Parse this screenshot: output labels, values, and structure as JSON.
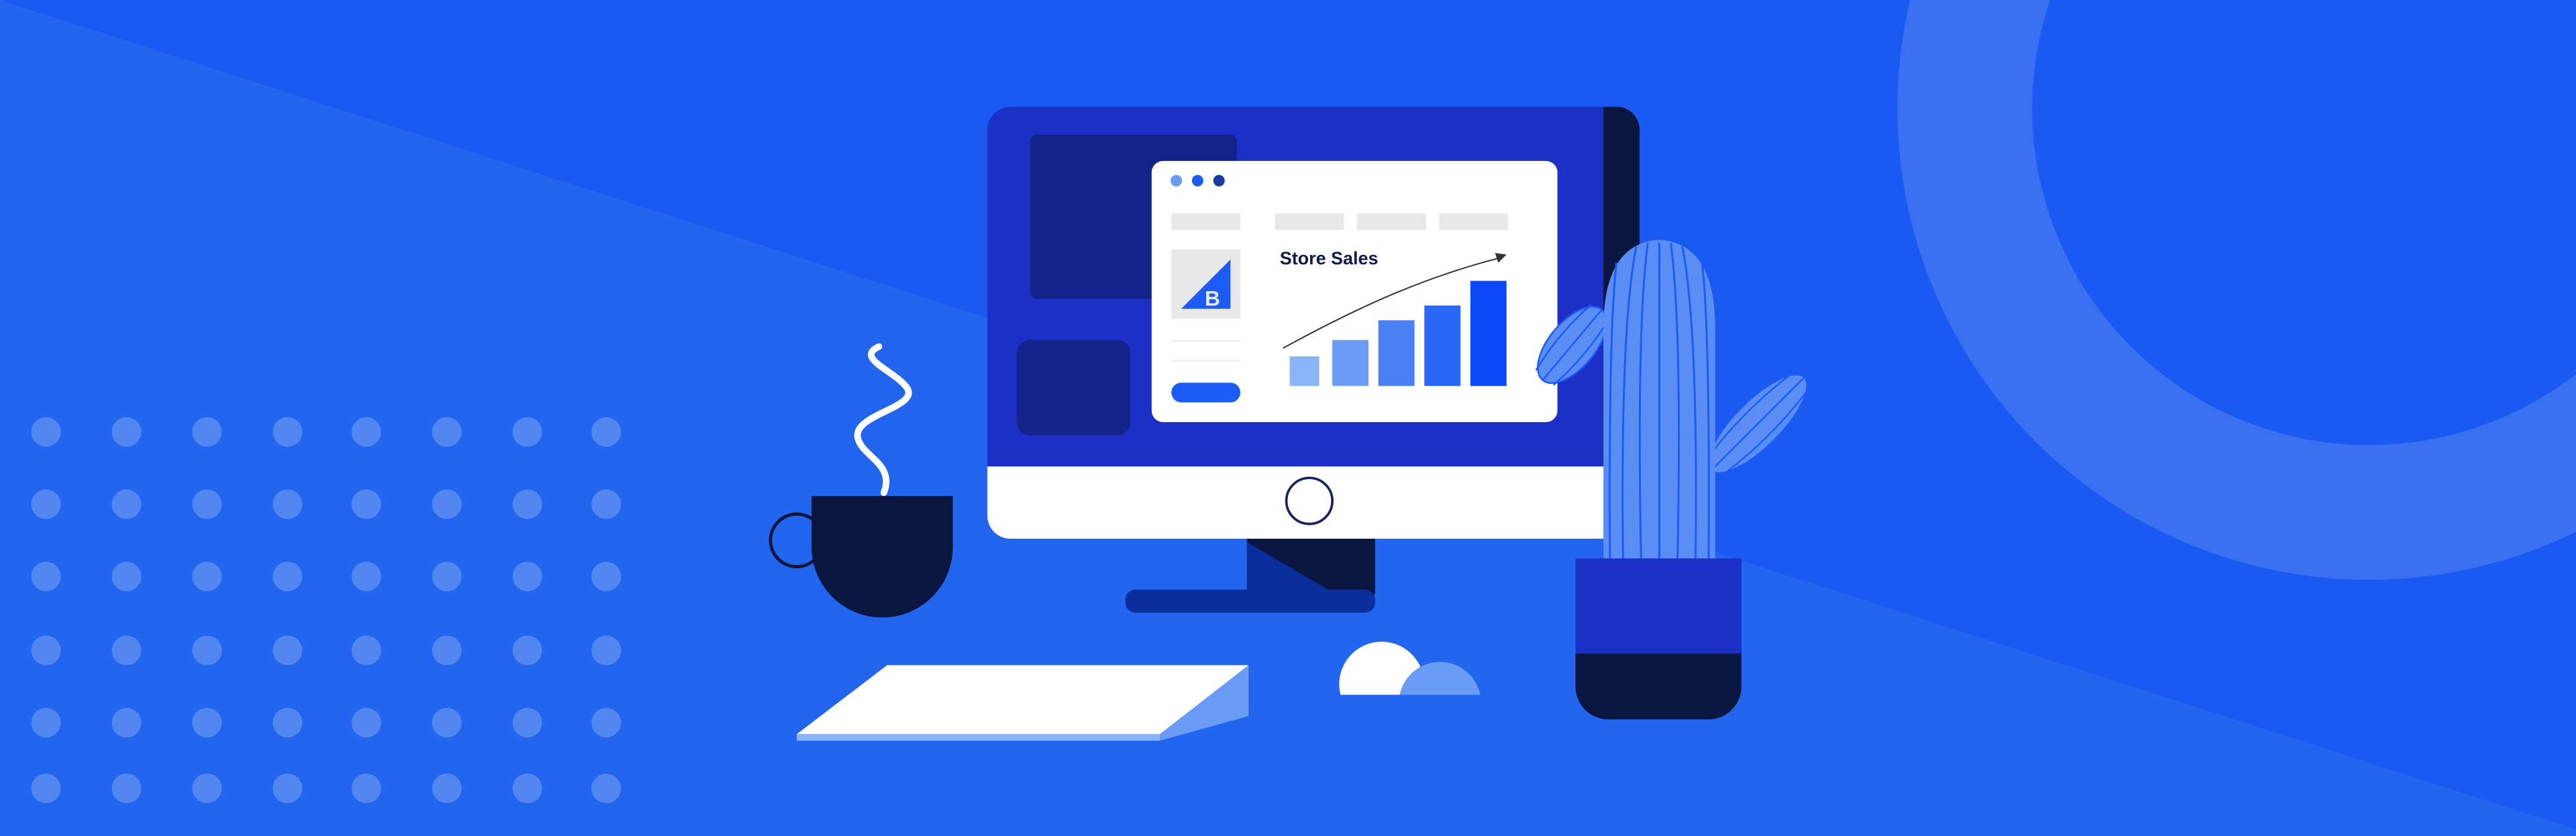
{
  "screen": {
    "chart_title": "Store Sales",
    "bar_levels": [
      18,
      28,
      40,
      49,
      64
    ],
    "bar_colors": [
      "#8ab4f8",
      "#6a9cf5",
      "#4a80f5",
      "#2a66f8",
      "#0a48f8"
    ],
    "window_dot_colors": [
      "#6a9af5",
      "#1a5cf5",
      "#1a3aa0"
    ],
    "logo_letter": "B"
  },
  "colors": {
    "background": "#1a5af3",
    "background_lower": "#2265ee",
    "monitor": "#1c2fc7",
    "navy": "#0a1540",
    "accent": "#1a5cf5",
    "cactus": "#5b8ef5"
  }
}
